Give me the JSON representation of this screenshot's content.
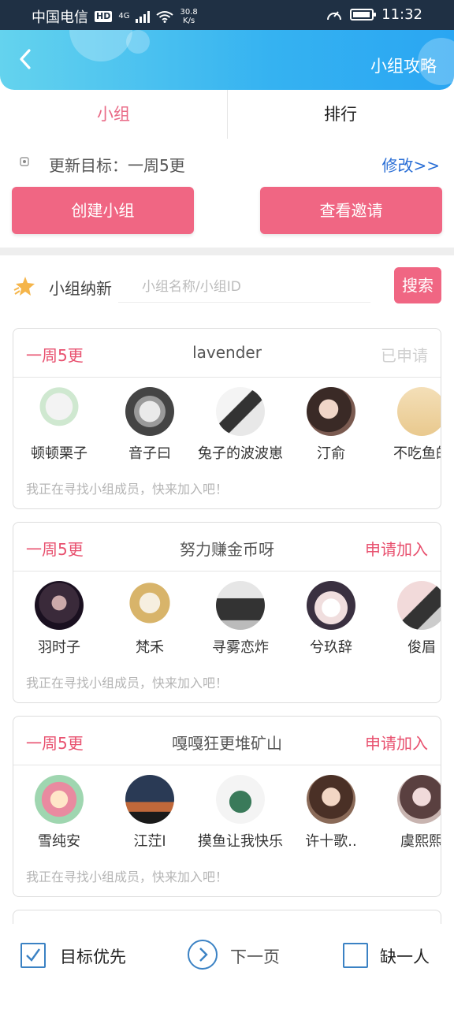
{
  "status_bar": {
    "carrier": "中国电信",
    "hd": "HD",
    "network": "4G",
    "speed_value": "30.8",
    "speed_unit": "K/s",
    "time": "11:32"
  },
  "header": {
    "title": "小组攻略"
  },
  "tabs": [
    {
      "label": "小组"
    },
    {
      "label": "排行"
    }
  ],
  "goal": {
    "text": "更新目标：一周5更",
    "edit_label": "修改>>"
  },
  "buttons": {
    "create_group": "创建小组",
    "view_invites": "查看邀请"
  },
  "recruit": {
    "label": "小组纳新",
    "search_placeholder": "小组名称/小组ID",
    "search_label": "搜索"
  },
  "groups": [
    {
      "target": "一周5更",
      "name": "lavender",
      "action": "已申请",
      "members": [
        "顿顿栗子",
        "音子曰",
        "兔子的波波崽",
        "汀俞",
        "不吃鱼的"
      ],
      "note": "我正在寻找小组成员，快来加入吧！"
    },
    {
      "target": "一周5更",
      "name": "努力赚金币呀",
      "action": "申请加入",
      "members": [
        "羽时子",
        "梵禾",
        "寻雾恋炸",
        "兮玖辞",
        "俊眉"
      ],
      "note": "我正在寻找小组成员，快来加入吧！"
    },
    {
      "target": "一周5更",
      "name": "嘎嘎狂更堆矿山",
      "action": "申请加入",
      "members": [
        "雪纯安",
        "江茳l",
        "摸鱼让我快乐",
        "许十歌..",
        "虞熙熙"
      ],
      "note": "我正在寻找小组成员，快来加入吧！"
    }
  ],
  "bottom_bar": {
    "priority_label": "目标优先",
    "priority_checked": true,
    "next_label": "下一页",
    "missing_one_label": "缺一人",
    "missing_one_checked": false
  },
  "colors": {
    "accent_pink": "#f06683",
    "header_blue": "#35b2f1",
    "link_blue": "#2b6fd6"
  }
}
